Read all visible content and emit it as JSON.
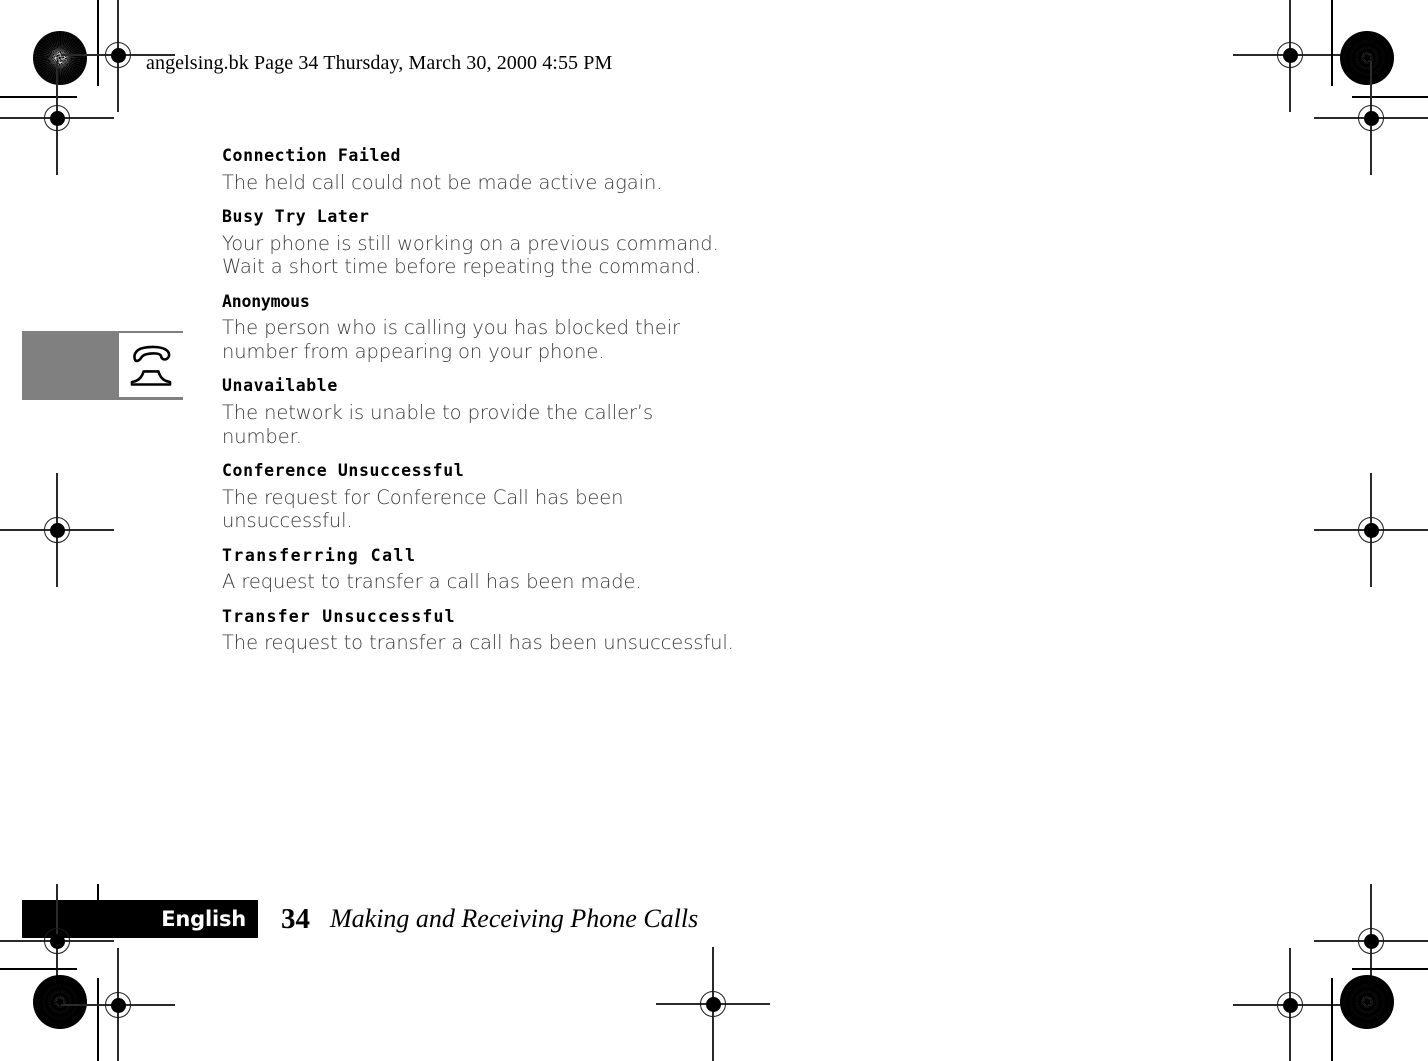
{
  "page": {
    "running_head": "angelsing.bk  Page 34  Thursday, March 30, 2000  4:55 PM",
    "background_color": "#ffffff",
    "ink_color": "#000000"
  },
  "margin_tab": {
    "background_color": "#808080",
    "icon": "telephone-handset-icon"
  },
  "content": {
    "sections": [
      {
        "term": "Connection Failed",
        "description": "The held call could not be made active again."
      },
      {
        "term": "Busy Try Later",
        "description": "Your phone is still working on a previous command. Wait a short time before repeating the command."
      },
      {
        "term": "Anonymous",
        "description": "The person who is calling you has blocked their number from appearing on your phone."
      },
      {
        "term": "Unavailable",
        "description": "The network is unable to provide the caller’s number."
      },
      {
        "term": "Conference Unsuccessful",
        "description": "The request for Conference Call has been unsuccessful."
      },
      {
        "term": "Transferring Call",
        "description": "A request to transfer a call has been made."
      },
      {
        "term": "Transfer Unsuccessful",
        "description": "The request to transfer a call has been unsuccessful."
      }
    ]
  },
  "footer": {
    "language": "English",
    "page_number": "34",
    "chapter_title": "Making and Receiving Phone Calls",
    "bar_color": "#000000"
  }
}
